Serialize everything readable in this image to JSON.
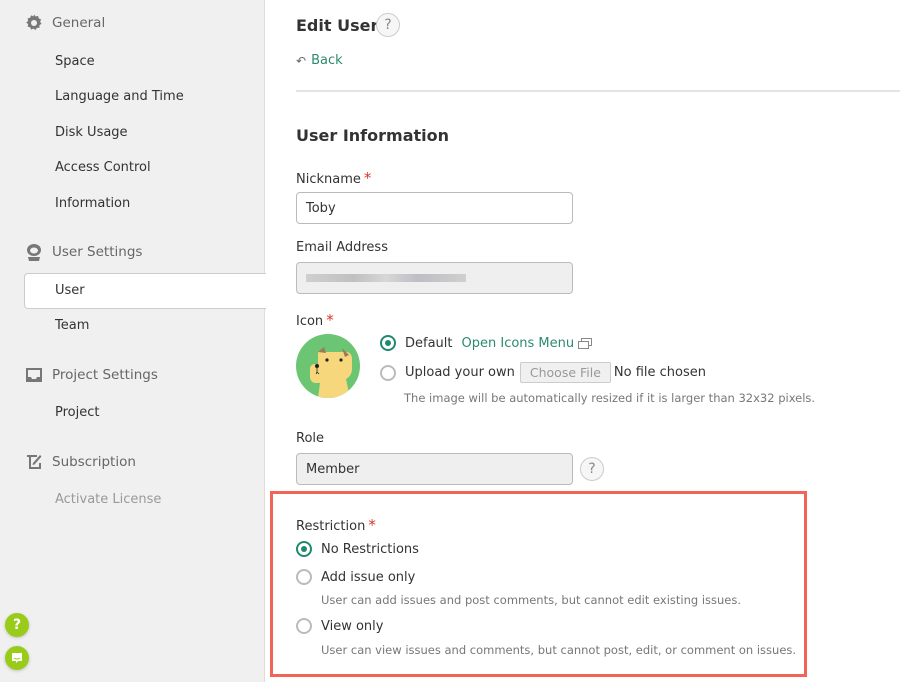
{
  "sidebar": {
    "sections": [
      {
        "title": "General",
        "icon": "gear-icon",
        "items": [
          {
            "label": "Space"
          },
          {
            "label": "Language and Time"
          },
          {
            "label": "Disk Usage"
          },
          {
            "label": "Access Control"
          },
          {
            "label": "Information"
          }
        ]
      },
      {
        "title": "User Settings",
        "icon": "user-icon",
        "items": [
          {
            "label": "User",
            "active": true
          },
          {
            "label": "Team"
          }
        ]
      },
      {
        "title": "Project Settings",
        "icon": "inbox-icon",
        "items": [
          {
            "label": "Project"
          }
        ]
      },
      {
        "title": "Subscription",
        "icon": "scroll-icon",
        "items": [
          {
            "label": "Activate License",
            "muted": true
          }
        ]
      }
    ],
    "floating": {
      "help": "?",
      "chat_icon": "chat-icon"
    }
  },
  "main": {
    "page_title": "Edit User",
    "help": "?",
    "back_label": "Back",
    "section_title": "User Information",
    "nickname": {
      "label": "Nickname",
      "required": "*",
      "value": "Toby"
    },
    "email": {
      "label": "Email Address",
      "value": ""
    },
    "icon": {
      "label": "Icon",
      "required": "*",
      "default_label": "Default",
      "open_menu_label": "Open Icons Menu",
      "upload_label": "Upload your own",
      "choose_file_label": "Choose File",
      "no_file_label": "No file chosen",
      "hint": "The image will be automatically resized if it is larger than 32x32 pixels.",
      "selected": "default"
    },
    "role": {
      "label": "Role",
      "value": "Member",
      "help": "?"
    },
    "restriction": {
      "label": "Restriction",
      "required": "*",
      "options": [
        {
          "label": "No Restrictions",
          "checked": true,
          "desc": ""
        },
        {
          "label": "Add issue only",
          "checked": false,
          "desc": "User can add issues and post comments, but cannot edit existing issues."
        },
        {
          "label": "View only",
          "checked": false,
          "desc": "User can view issues and comments, but cannot post, edit, or comment on issues."
        }
      ]
    },
    "colors": {
      "accent": "#1f8a70",
      "link": "#2d8a70",
      "required": "#d9342b",
      "highlight": "#f26457",
      "float_button": "#99cc1a"
    }
  }
}
